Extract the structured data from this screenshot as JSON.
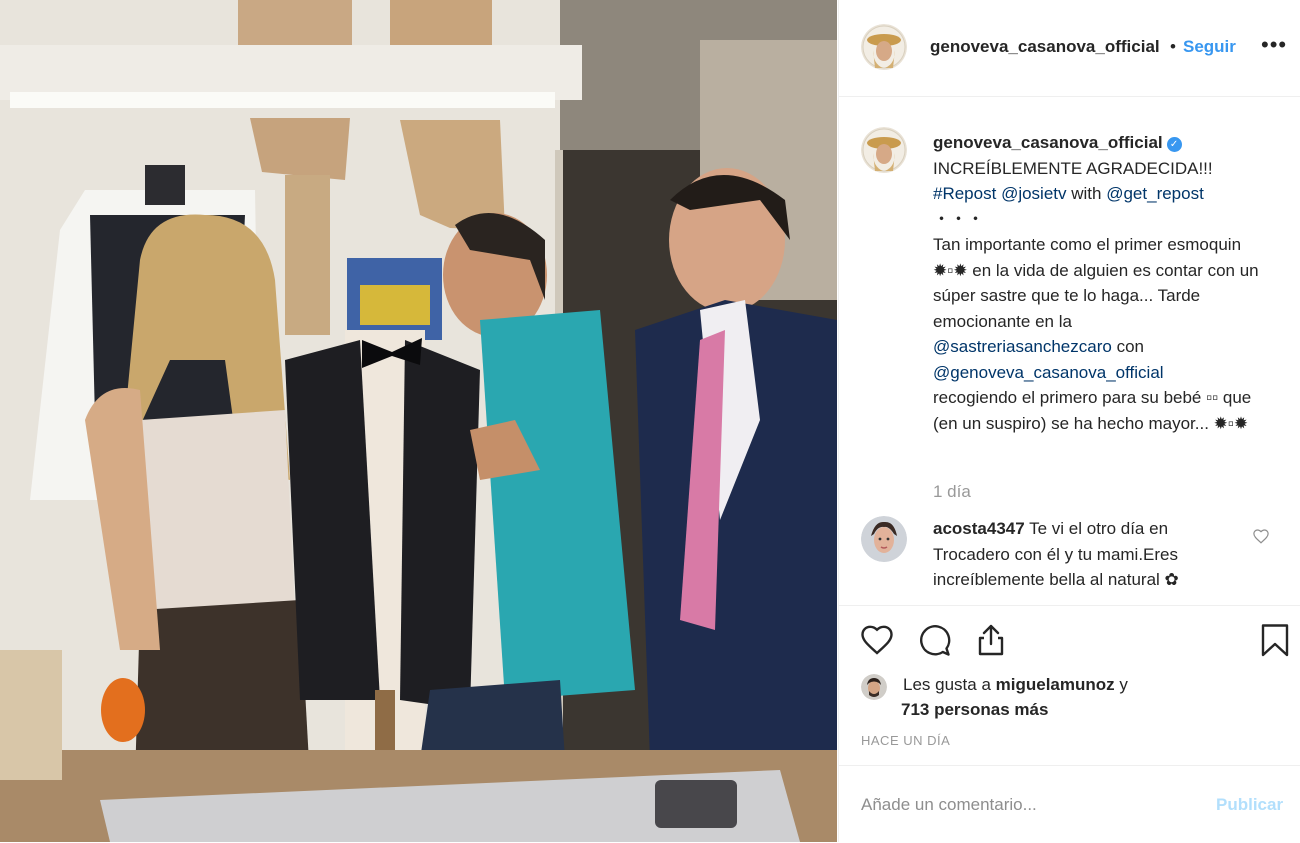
{
  "post": {
    "photo_icon": "tailor-shop-photo",
    "header": {
      "username": "genoveva_casanova_official",
      "separator": "•",
      "follow_label": "Seguir",
      "more_icon": "more-options-icon"
    },
    "caption": {
      "username": "genoveva_casanova_official",
      "verified_icon": "verified-badge-icon",
      "line1": "INCREÍBLEMENTE AGRADECIDA!!!",
      "repost_tag": "#Repost",
      "repost_user": "@josietv",
      "with_word": "with",
      "repost_app": "@get_repost",
      "dots": "・・・",
      "body1": "Tan importante como el primer esmoquin ✹▫✹ en la vida de alguien es contar con un súper sastre que te lo haga... Tarde emocionante en la",
      "mention1": "@sastreriasanchezcaro",
      "con_word": "con",
      "mention2": "@genoveva_casanova_official",
      "body2": "recogiendo el primero para su bebé ▫▫ que (en un suspiro) se ha hecho mayor... ✹▫✹"
    },
    "time_ago": "1 día",
    "comment": {
      "username": "acosta4347",
      "text": "Te vi el otro día en Trocadero con él y tu mami.Eres increíblemente bella al natural ✿"
    },
    "actions": {
      "like_icon": "heart-icon",
      "comment_icon": "comment-icon",
      "share_icon": "share-icon",
      "save_icon": "bookmark-icon"
    },
    "likes": {
      "prefix": "Les gusta a",
      "liker": "miguelamunoz",
      "suffix": "y",
      "others": "713 personas más"
    },
    "posted_label": "HACE UN DÍA",
    "comment_input": {
      "placeholder": "Añade un comentario...",
      "submit_label": "Publicar"
    }
  }
}
